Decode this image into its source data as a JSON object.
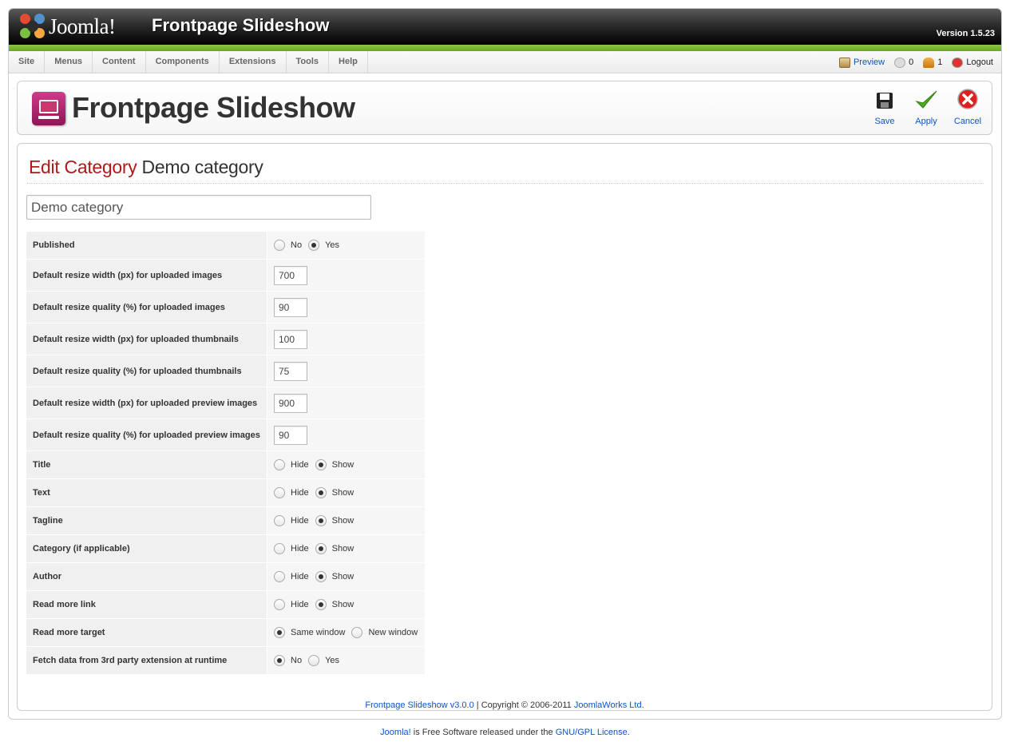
{
  "header": {
    "logo_text": "Joomla!",
    "app_title": "Frontpage Slideshow",
    "version": "Version 1.5.23"
  },
  "menu": [
    "Site",
    "Menus",
    "Content",
    "Components",
    "Extensions",
    "Tools",
    "Help"
  ],
  "status": {
    "preview": "Preview",
    "messages": "0",
    "users": "1",
    "logout": "Logout"
  },
  "toolbar": {
    "title": "Frontpage Slideshow",
    "save": "Save",
    "apply": "Apply",
    "cancel": "Cancel"
  },
  "edit": {
    "heading_action": "Edit Category",
    "heading_name": "Demo category",
    "name_value": "Demo category"
  },
  "params": [
    {
      "label": "Published",
      "type": "radio",
      "options": [
        "No",
        "Yes"
      ],
      "selected": 1
    },
    {
      "label": "Default resize width (px) for uploaded images",
      "type": "text",
      "value": "700"
    },
    {
      "label": "Default resize quality (%) for uploaded images",
      "type": "text",
      "value": "90"
    },
    {
      "label": "Default resize width (px) for uploaded thumbnails",
      "type": "text",
      "value": "100"
    },
    {
      "label": "Default resize quality (%) for uploaded thumbnails",
      "type": "text",
      "value": "75"
    },
    {
      "label": "Default resize width (px) for uploaded preview images",
      "type": "text",
      "value": "900"
    },
    {
      "label": "Default resize quality (%) for uploaded preview images",
      "type": "text",
      "value": "90"
    },
    {
      "label": "Title",
      "type": "radio",
      "options": [
        "Hide",
        "Show"
      ],
      "selected": 1
    },
    {
      "label": "Text",
      "type": "radio",
      "options": [
        "Hide",
        "Show"
      ],
      "selected": 1
    },
    {
      "label": "Tagline",
      "type": "radio",
      "options": [
        "Hide",
        "Show"
      ],
      "selected": 1
    },
    {
      "label": "Category (if applicable)",
      "type": "radio",
      "options": [
        "Hide",
        "Show"
      ],
      "selected": 1
    },
    {
      "label": "Author",
      "type": "radio",
      "options": [
        "Hide",
        "Show"
      ],
      "selected": 1
    },
    {
      "label": "Read more link",
      "type": "radio",
      "options": [
        "Hide",
        "Show"
      ],
      "selected": 1
    },
    {
      "label": "Read more target",
      "type": "radio",
      "options": [
        "Same window",
        "New window"
      ],
      "selected": 0
    },
    {
      "label": "Fetch data from 3rd party extension at runtime",
      "type": "radio",
      "options": [
        "No",
        "Yes"
      ],
      "selected": 0
    }
  ],
  "copyright": {
    "product_link": "Frontpage Slideshow v3.0.0",
    "middle": " | Copyright © 2006-2011 ",
    "company_link": "JoomlaWorks Ltd."
  },
  "footer": {
    "joomla_link": "Joomla!",
    "middle": " is Free Software released under the ",
    "license_link": "GNU/GPL License."
  },
  "colors": {
    "accent_red": "#b11818",
    "link_blue": "#0b55c4",
    "header_green": "#8fc63f",
    "icon_magenta": "#c7386f"
  }
}
